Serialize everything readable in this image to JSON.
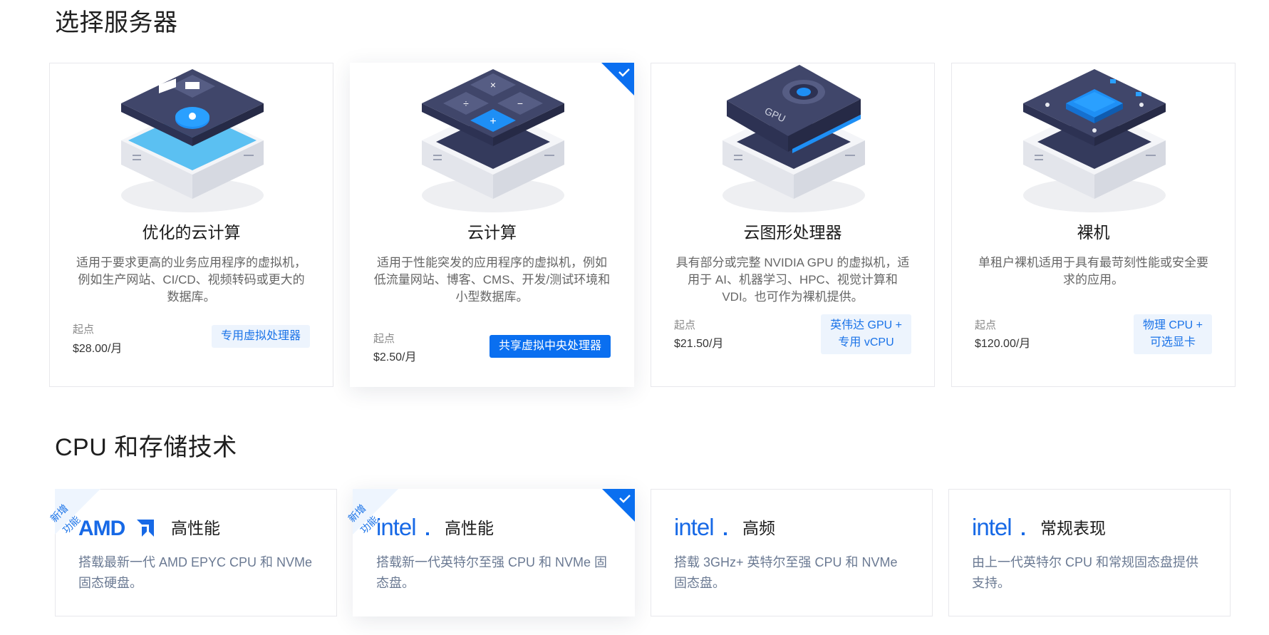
{
  "sections": {
    "servers_title": "选择服务器",
    "cpu_title": "CPU 和存储技术"
  },
  "servers": [
    {
      "title": "优化的云计算",
      "desc": "适用于要求更高的业务应用程序的虚拟机，例如生产网站、CI/CD、视频转码或更大的数据库。",
      "price_label": "起点",
      "price": "$28.00/月",
      "badge": "专用虚拟处理器",
      "selected": false,
      "icon": "optimized-cloud-icon"
    },
    {
      "title": "云计算",
      "desc": "适用于性能突发的应用程序的虚拟机，例如低流量网站、博客、CMS、开发/测试环境和小型数据库。",
      "price_label": "起点",
      "price": "$2.50/月",
      "badge": "共享虚拟中央处理器",
      "selected": true,
      "icon": "cloud-compute-icon"
    },
    {
      "title": "云图形处理器",
      "desc": "具有部分或完整 NVIDIA GPU 的虚拟机，适用于 AI、机器学习、HPC、视觉计算和 VDI。也可作为裸机提供。",
      "price_label": "起点",
      "price": "$21.50/月",
      "badge_line1": "英伟达 GPU +",
      "badge_line2": "专用 vCPU",
      "selected": false,
      "icon": "cloud-gpu-icon"
    },
    {
      "title": "裸机",
      "desc": "单租户裸机适用于具有最苛刻性能或安全要求的应用。",
      "price_label": "起点",
      "price": "$120.00/月",
      "badge_line1": "物理 CPU +",
      "badge_line2": "可选显卡",
      "selected": false,
      "icon": "bare-metal-icon"
    }
  ],
  "cpus": [
    {
      "brand": "AMD",
      "logo_icon": "amd-logo-icon",
      "tier": "高性能",
      "desc": "搭载最新一代 AMD EPYC CPU 和 NVMe 固态硬盘。",
      "new_line1": "新增",
      "new_line2": "功能",
      "selected": false
    },
    {
      "brand": "intel",
      "logo_icon": "intel-logo-icon",
      "tier": "高性能",
      "desc": "搭载新一代英特尔至强 CPU 和 NVMe 固态盘。",
      "new_line1": "新增",
      "new_line2": "功能",
      "selected": true
    },
    {
      "brand": "intel",
      "logo_icon": "intel-logo-icon",
      "tier": "高频",
      "desc": "搭载 3GHz+ 英特尔至强 CPU 和 NVMe 固态盘。",
      "selected": false
    },
    {
      "brand": "intel",
      "logo_icon": "intel-logo-icon",
      "tier": "常规表现",
      "desc": "由上一代英特尔 CPU 和常规固态盘提供支持。",
      "selected": false
    }
  ],
  "colors": {
    "accent": "#0a6ff0",
    "badge_bg": "#edf4fd",
    "illustration_dark": "#3a4063",
    "illustration_blue": "#1e8ff5"
  }
}
